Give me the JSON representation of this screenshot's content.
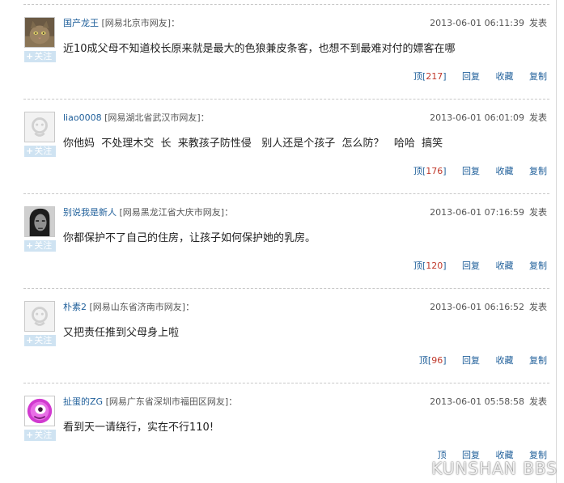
{
  "ui": {
    "follow_label": "关注",
    "follow_plus": "+",
    "publish_label": "发表",
    "up_label": "顶",
    "reply_label": "回复",
    "favorite_label": "收藏",
    "copy_label": "复制",
    "bracket_open": "[",
    "bracket_close": "]",
    "colon": "："
  },
  "comments": [
    {
      "username": "国产龙王",
      "location": "[网易北京市网友]",
      "time": "2013-06-01 06:11:39",
      "text": "近10成父母不知道校长原来就是最大的色狼兼皮条客，也想不到最难对付的嫖客在哪",
      "up_count": "217",
      "avatar": "cat-photo"
    },
    {
      "username": "liao0008",
      "location": "[网易湖北省武汉市网友]",
      "time": "2013-06-01 06:01:09",
      "text": "你他妈  不处理木交  长  来教孩子防性侵   别人还是个孩子  怎么防？   哈哈  搞笑",
      "up_count": "176",
      "avatar": "default-avatar"
    },
    {
      "username": "别说我是新人",
      "location": "[网易黑龙江省大庆市网友]",
      "time": "2013-06-01 07:16:59",
      "text": "你都保护不了自己的住房，让孩子如何保护她的乳房。",
      "up_count": "120",
      "avatar": "man-portrait-bw"
    },
    {
      "username": "朴素2",
      "location": "[网易山东省济南市网友]",
      "time": "2013-06-01 06:16:52",
      "text": "又把责任推到父母身上啦",
      "up_count": "96",
      "avatar": "default-avatar"
    },
    {
      "username": "扯蛋的ZG",
      "location": "[网易广东省深圳市福田区网友]",
      "time": "2013-06-01 05:58:58",
      "text": "看到天一请绕行，实在不行110!",
      "up_count": "",
      "avatar": "pink-cartoon"
    }
  ],
  "watermark": "KUNSHAN BBS",
  "colors": {
    "link": "#1f5f9a",
    "count": "#c0392b",
    "follow_bg": "#cfe3f2",
    "separator": "#c8c8c8"
  }
}
